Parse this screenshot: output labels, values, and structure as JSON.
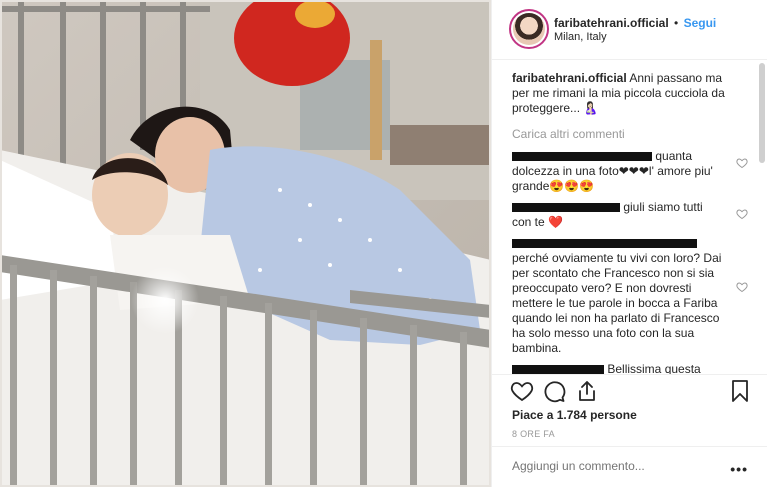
{
  "header": {
    "username": "faribatehrani.official",
    "separator": "•",
    "follow_label": "Segui",
    "location": "Milan, Italy"
  },
  "caption": {
    "username": "faribatehrani.official",
    "text": "Anni passano ma per me rimani la mia piccola cucciola da proteggere... 🤱🏻"
  },
  "load_more_label": "Carica altri commenti",
  "comments": [
    {
      "text": "quanta dolcezza in una foto❤❤❤l' amore piu' grande😍😍😍"
    },
    {
      "text": "giuli siamo tutti con te ❤️"
    },
    {
      "text": "perché ovviamente tu vivi con loro? Dai per scontato che Francesco non si sia preoccupato vero? E non dovresti mettere le tue parole in bocca a Fariba quando lei non ha parlato di Francesco ha solo messo una foto con la sua bambina."
    },
    {
      "text": "Bellissima questa"
    }
  ],
  "likes_text": "Piace a 1.784 persone",
  "time_text": "8 ORE FA",
  "add_comment_placeholder": "Aggiungi un commento...",
  "more_label": "•••",
  "icons": {
    "like": "heart-icon",
    "comment": "comment-icon",
    "share": "share-icon",
    "save": "bookmark-icon"
  }
}
